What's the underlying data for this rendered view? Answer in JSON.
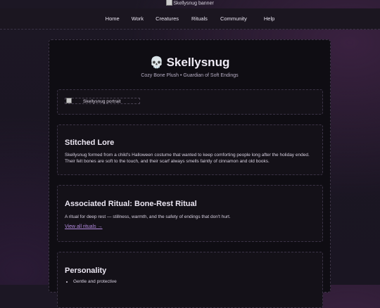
{
  "banner": {
    "alt": "Skellysnug banner"
  },
  "nav": {
    "items": [
      "Home",
      "Work",
      "Creatures",
      "Rituals",
      "Community",
      "Help"
    ]
  },
  "header": {
    "icon": "💀",
    "title": "Skellysnug",
    "subtitle": "Cozy Bone Plush • Guardian of Soft Endings"
  },
  "portrait": {
    "alt": "Skellysnug portrait"
  },
  "lore": {
    "heading": "Stitched Lore",
    "text": "Skellysnug formed from a child's Halloween costume that wanted to keep comforting people long after the holiday ended. Their felt bones are soft to the touch, and their scarf always smells faintly of cinnamon and old books."
  },
  "ritual": {
    "heading": "Associated Ritual: Bone-Rest Ritual",
    "text": "A ritual for deep rest — stillness, warmth, and the safety of endings that don't hurt.",
    "link": "View all rituals →"
  },
  "personality": {
    "heading": "Personality",
    "items": [
      "Gentle and protective"
    ]
  }
}
